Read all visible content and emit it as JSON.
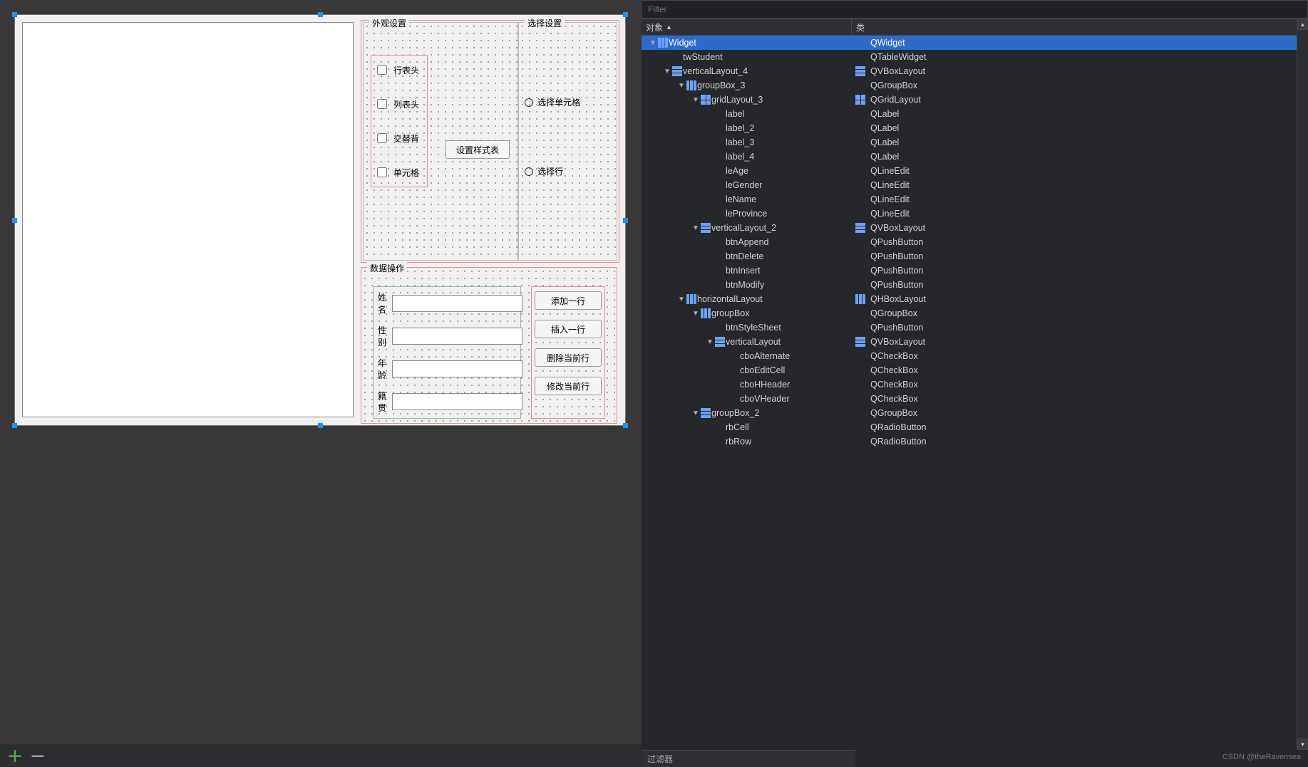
{
  "designer": {
    "appearance": {
      "title": "外观设置",
      "checkboxes": [
        "行表头",
        "列表头",
        "交替背",
        "单元格"
      ],
      "stylesheet_btn": "设置样式表"
    },
    "selection": {
      "title": "选择设置",
      "radios": [
        "选择单元格",
        "选择行"
      ]
    },
    "data_ops": {
      "title": "数据操作",
      "labels": [
        "姓名",
        "性别",
        "年龄",
        "籍贯"
      ],
      "buttons": [
        "添加一行",
        "插入一行",
        "删除当前行",
        "修改当前行"
      ]
    }
  },
  "inspector": {
    "filter_placeholder": "Filter",
    "col_object": "对象",
    "col_class": "类",
    "footer_filter": "过滤器",
    "watermark": "CSDN @theRavensea",
    "tree": [
      {
        "depth": 0,
        "exp": "▼",
        "icon": "hbox",
        "obj": "Widget",
        "cls": "QWidget",
        "cicon": "",
        "sel": true
      },
      {
        "depth": 1,
        "exp": "",
        "icon": "",
        "obj": "twStudent",
        "cls": "QTableWidget",
        "cicon": ""
      },
      {
        "depth": 1,
        "exp": "▼",
        "icon": "vbox",
        "obj": "verticalLayout_4",
        "cls": "QVBoxLayout",
        "cicon": "vbox"
      },
      {
        "depth": 2,
        "exp": "▼",
        "icon": "hbox",
        "obj": "groupBox_3",
        "cls": "QGroupBox",
        "cicon": ""
      },
      {
        "depth": 3,
        "exp": "▼",
        "icon": "grid",
        "obj": "gridLayout_3",
        "cls": "QGridLayout",
        "cicon": "grid"
      },
      {
        "depth": 4,
        "exp": "",
        "icon": "",
        "obj": "label",
        "cls": "QLabel",
        "cicon": ""
      },
      {
        "depth": 4,
        "exp": "",
        "icon": "",
        "obj": "label_2",
        "cls": "QLabel",
        "cicon": ""
      },
      {
        "depth": 4,
        "exp": "",
        "icon": "",
        "obj": "label_3",
        "cls": "QLabel",
        "cicon": ""
      },
      {
        "depth": 4,
        "exp": "",
        "icon": "",
        "obj": "label_4",
        "cls": "QLabel",
        "cicon": ""
      },
      {
        "depth": 4,
        "exp": "",
        "icon": "",
        "obj": "leAge",
        "cls": "QLineEdit",
        "cicon": ""
      },
      {
        "depth": 4,
        "exp": "",
        "icon": "",
        "obj": "leGender",
        "cls": "QLineEdit",
        "cicon": ""
      },
      {
        "depth": 4,
        "exp": "",
        "icon": "",
        "obj": "leName",
        "cls": "QLineEdit",
        "cicon": ""
      },
      {
        "depth": 4,
        "exp": "",
        "icon": "",
        "obj": "leProvince",
        "cls": "QLineEdit",
        "cicon": ""
      },
      {
        "depth": 3,
        "exp": "▼",
        "icon": "vbox",
        "obj": "verticalLayout_2",
        "cls": "QVBoxLayout",
        "cicon": "vbox"
      },
      {
        "depth": 4,
        "exp": "",
        "icon": "",
        "obj": "btnAppend",
        "cls": "QPushButton",
        "cicon": ""
      },
      {
        "depth": 4,
        "exp": "",
        "icon": "",
        "obj": "btnDelete",
        "cls": "QPushButton",
        "cicon": ""
      },
      {
        "depth": 4,
        "exp": "",
        "icon": "",
        "obj": "btnInsert",
        "cls": "QPushButton",
        "cicon": ""
      },
      {
        "depth": 4,
        "exp": "",
        "icon": "",
        "obj": "btnModify",
        "cls": "QPushButton",
        "cicon": ""
      },
      {
        "depth": 2,
        "exp": "▼",
        "icon": "hbox",
        "obj": "horizontalLayout",
        "cls": "QHBoxLayout",
        "cicon": "hbox"
      },
      {
        "depth": 3,
        "exp": "▼",
        "icon": "hbox",
        "obj": "groupBox",
        "cls": "QGroupBox",
        "cicon": ""
      },
      {
        "depth": 4,
        "exp": "",
        "icon": "",
        "obj": "btnStyleSheet",
        "cls": "QPushButton",
        "cicon": ""
      },
      {
        "depth": 4,
        "exp": "▼",
        "icon": "vbox",
        "obj": "verticalLayout",
        "cls": "QVBoxLayout",
        "cicon": "vbox"
      },
      {
        "depth": 5,
        "exp": "",
        "icon": "",
        "obj": "cboAlternate",
        "cls": "QCheckBox",
        "cicon": ""
      },
      {
        "depth": 5,
        "exp": "",
        "icon": "",
        "obj": "cboEditCell",
        "cls": "QCheckBox",
        "cicon": ""
      },
      {
        "depth": 5,
        "exp": "",
        "icon": "",
        "obj": "cboHHeader",
        "cls": "QCheckBox",
        "cicon": ""
      },
      {
        "depth": 5,
        "exp": "",
        "icon": "",
        "obj": "cboVHeader",
        "cls": "QCheckBox",
        "cicon": ""
      },
      {
        "depth": 3,
        "exp": "▼",
        "icon": "vbox",
        "obj": "groupBox_2",
        "cls": "QGroupBox",
        "cicon": ""
      },
      {
        "depth": 4,
        "exp": "",
        "icon": "",
        "obj": "rbCell",
        "cls": "QRadioButton",
        "cicon": ""
      },
      {
        "depth": 4,
        "exp": "",
        "icon": "",
        "obj": "rbRow",
        "cls": "QRadioButton",
        "cicon": ""
      }
    ]
  }
}
